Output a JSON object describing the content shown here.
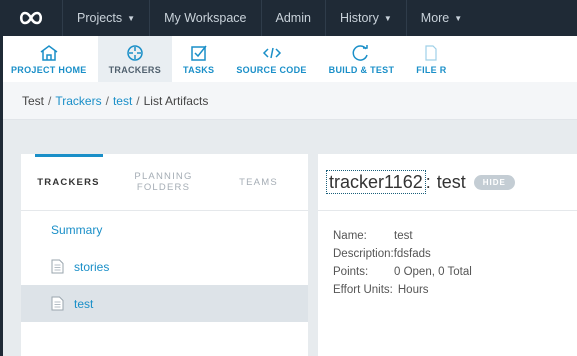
{
  "topnav": {
    "items": [
      {
        "label": "Projects",
        "dropdown": true
      },
      {
        "label": "My Workspace",
        "dropdown": false
      },
      {
        "label": "Admin",
        "dropdown": false
      },
      {
        "label": "History",
        "dropdown": true
      },
      {
        "label": "More",
        "dropdown": true
      }
    ]
  },
  "toolbar": {
    "items": [
      {
        "label": "PROJECT HOME",
        "icon": "home-icon"
      },
      {
        "label": "TRACKERS",
        "icon": "crosshair-icon",
        "active": true
      },
      {
        "label": "TASKS",
        "icon": "checkbox-icon"
      },
      {
        "label": "SOURCE CODE",
        "icon": "code-icon"
      },
      {
        "label": "BUILD & TEST",
        "icon": "refresh-icon"
      },
      {
        "label": "FILE R",
        "icon": "file-icon"
      }
    ]
  },
  "breadcrumb": {
    "root": "Test",
    "trackers": "Trackers",
    "tracker": "test",
    "current": "List Artifacts",
    "sep": "/"
  },
  "tabs": {
    "trackers": "TRACKERS",
    "planning_line1": "PLANNING",
    "planning_line2": "FOLDERS",
    "teams": "TEAMS"
  },
  "tracker_list": {
    "summary": "Summary",
    "items": [
      {
        "label": "stories",
        "selected": false
      },
      {
        "label": "test",
        "selected": true
      }
    ]
  },
  "detail": {
    "tracker_id": "tracker1162",
    "colon": ":",
    "title": "test",
    "hide_label": "HIDE",
    "fields": [
      {
        "key": "Name:",
        "value": "test"
      },
      {
        "key": "Description:",
        "value": "fdsfads"
      },
      {
        "key": "Points:",
        "value": "0 Open, 0 Total"
      },
      {
        "key": "Effort Units:",
        "value": "Hours"
      }
    ]
  },
  "colors": {
    "nav_bg": "#1f2a36",
    "accent": "#1a8fc8",
    "content_bg": "#e7ebee"
  }
}
